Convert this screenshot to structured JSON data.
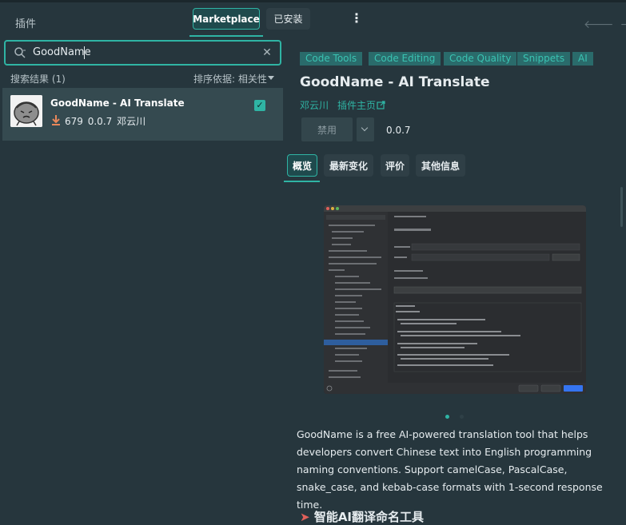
{
  "window": {
    "title": "插件"
  },
  "tabs": {
    "marketplace": "Marketplace",
    "installed": "已安装"
  },
  "menu": {
    "kebab": "⋮"
  },
  "search": {
    "value": "GoodName",
    "clear": "✕"
  },
  "results": {
    "label": "搜索结果 (1)",
    "sort": "排序依据: 相关性"
  },
  "result_item": {
    "name": "GoodName - AI Translate",
    "downloads": "679",
    "version": "0.0.7",
    "vendor": "邓云川",
    "checked": "✓"
  },
  "detail": {
    "tags": [
      "Code Tools",
      "Code Editing",
      "Code Quality",
      "Snippets",
      "AI"
    ],
    "title": "GoodName - AI Translate",
    "author": "邓云川",
    "homepage": "插件主页",
    "disable_button": "禁用",
    "version": "0.0.7",
    "tabs": [
      "概览",
      "最新变化",
      "评价",
      "其他信息"
    ],
    "description": "GoodName is a free AI-powered translation tool that helps developers convert Chinese text into English programming naming conventions. Support camelCase, PascalCase, snake_case, and kebab-case formats with 1-second response time.",
    "next_heading": "智能AI翻译命名工具"
  },
  "colors": {
    "accent": "#2fb4a4",
    "background": "#26363d",
    "selected_row": "#354a50",
    "download": "#e8875a"
  },
  "icons": [
    "search-icon",
    "clear-icon",
    "download-icon",
    "checkbox-icon",
    "external-link-icon",
    "chevron-down-icon",
    "kebab-icon",
    "back-arrow-icon",
    "forward-arrow-icon"
  ]
}
